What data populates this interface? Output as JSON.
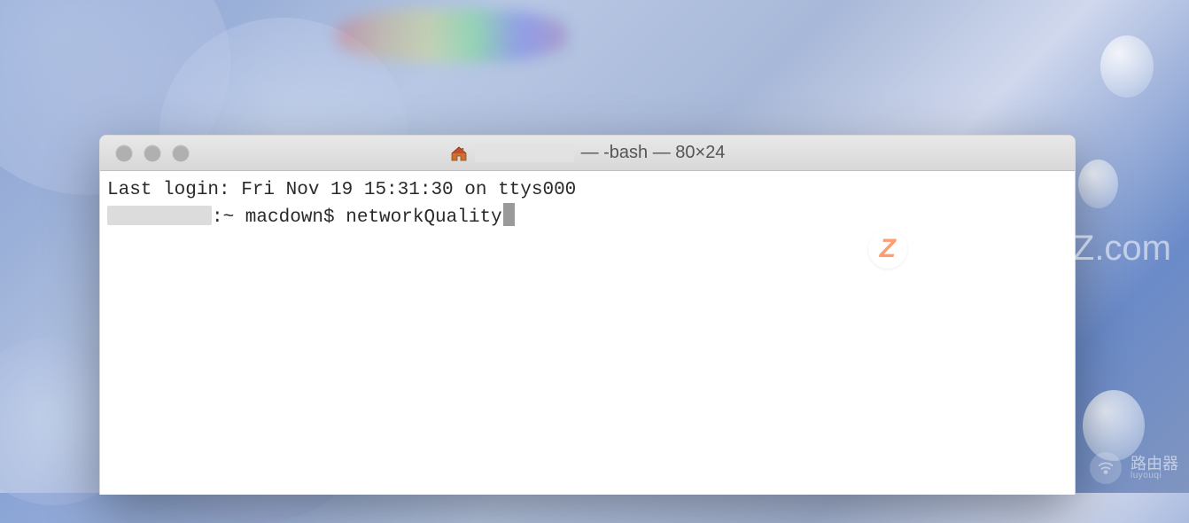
{
  "window": {
    "title_suffix": "— -bash — 80×24"
  },
  "terminal": {
    "last_login_line": "Last login: Fri Nov 19 15:31:30 on ttys000",
    "prompt_suffix": ":~ macdown$ ",
    "command": "networkQuality"
  },
  "watermarks": {
    "macz": {
      "badge": "Z",
      "text": "www.MacZ.com"
    },
    "router": {
      "cn": "路由器",
      "py": "luyouqi"
    }
  }
}
